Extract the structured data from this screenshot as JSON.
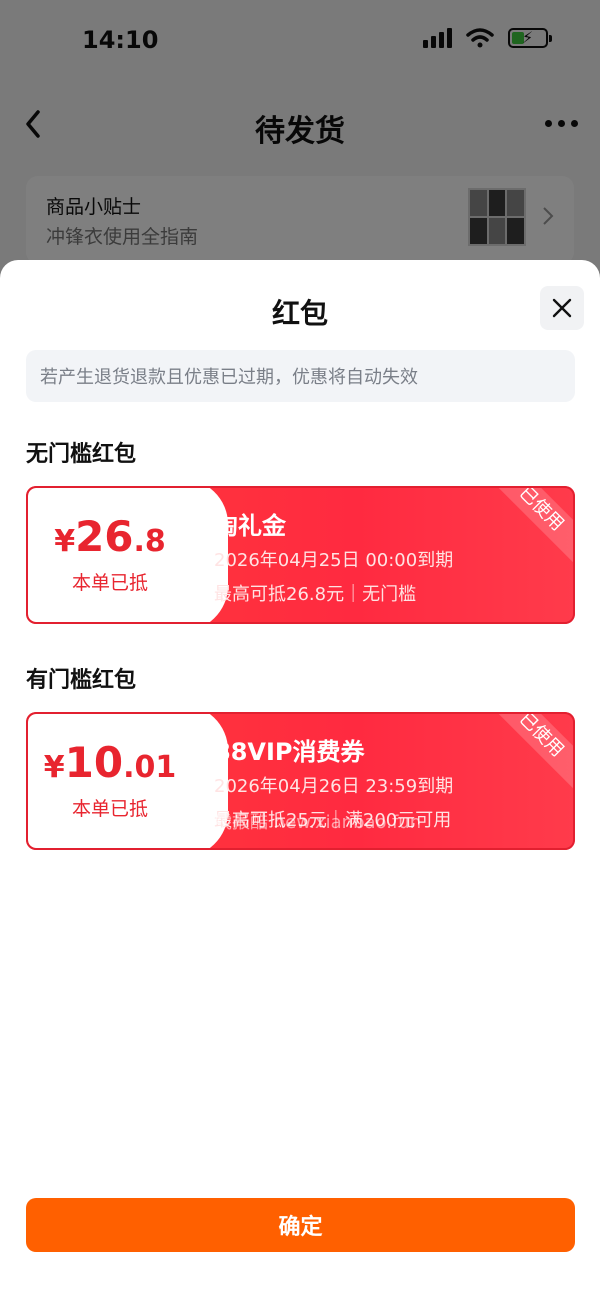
{
  "status_bar": {
    "time": "14:10"
  },
  "nav": {
    "title": "待发货"
  },
  "tip": {
    "title": "商品小贴士",
    "subtitle": "冲锋衣使用全指南"
  },
  "sheet": {
    "title": "红包",
    "notice": "若产生退货退款且优惠已过期，优惠将自动失效",
    "sections": [
      {
        "heading": "无门槛红包",
        "coupon": {
          "currency": "¥",
          "amount_int": "26",
          "amount_dec": ".8",
          "amount_note": "本单已抵",
          "name": "淘礼金",
          "expire": "2026年04月25日 00:00到期",
          "limit": "最高可抵26.8元｜无门槛",
          "stamp": "已使用"
        }
      },
      {
        "heading": "有门槛红包",
        "coupon": {
          "currency": "¥",
          "amount_int": "10",
          "amount_dec": ".01",
          "amount_note": "本单已抵",
          "name": "88VIP消费券",
          "expire": "2026年04月26日 23:59到期",
          "limit": "最高可抵25元｜满200元可用",
          "stamp": "已使用"
        }
      }
    ],
    "watermark": "线报酷 new.xianbao.fun",
    "confirm_label": "确定"
  },
  "colors": {
    "accent_red": "#e8252f",
    "coupon_bg": "#ff3a3a",
    "confirm_orange": "#ff6000"
  },
  "icons": [
    "back-icon",
    "more-icon",
    "chevron-right-icon",
    "close-icon",
    "signal-icon",
    "wifi-icon",
    "battery-icon"
  ]
}
